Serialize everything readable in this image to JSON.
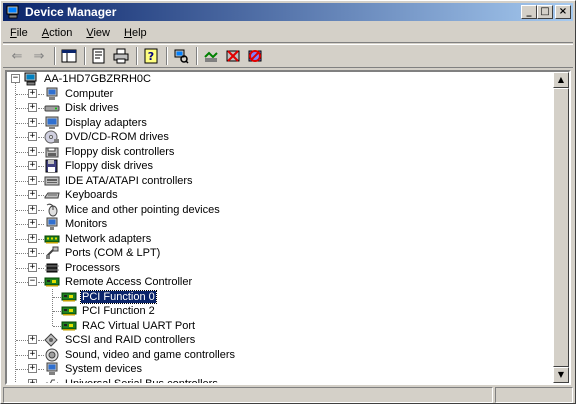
{
  "window": {
    "title": "Device Manager"
  },
  "menu": [
    {
      "label": "File",
      "key": "F"
    },
    {
      "label": "Action",
      "key": "A"
    },
    {
      "label": "View",
      "key": "V"
    },
    {
      "label": "Help",
      "key": "H"
    }
  ],
  "tree": {
    "root": "AA-1HD7GBZRRH0C",
    "items": [
      {
        "label": "Computer",
        "icon": "computer-icon",
        "expander": "+"
      },
      {
        "label": "Disk drives",
        "icon": "disk-drive-icon",
        "expander": "+"
      },
      {
        "label": "Display adapters",
        "icon": "display-adapter-icon",
        "expander": "+"
      },
      {
        "label": "DVD/CD-ROM drives",
        "icon": "cdrom-icon",
        "expander": "+"
      },
      {
        "label": "Floppy disk controllers",
        "icon": "floppy-controller-icon",
        "expander": "+"
      },
      {
        "label": "Floppy disk drives",
        "icon": "floppy-drive-icon",
        "expander": "+"
      },
      {
        "label": "IDE ATA/ATAPI controllers",
        "icon": "ide-controller-icon",
        "expander": "+"
      },
      {
        "label": "Keyboards",
        "icon": "keyboard-icon",
        "expander": "+"
      },
      {
        "label": "Mice and other pointing devices",
        "icon": "mouse-icon",
        "expander": "+"
      },
      {
        "label": "Monitors",
        "icon": "monitor-icon",
        "expander": "+"
      },
      {
        "label": "Network adapters",
        "icon": "network-adapter-icon",
        "expander": "+"
      },
      {
        "label": "Ports (COM & LPT)",
        "icon": "port-icon",
        "expander": "+"
      },
      {
        "label": "Processors",
        "icon": "processor-icon",
        "expander": "+"
      },
      {
        "label": "Remote Access Controller",
        "icon": "board-icon",
        "expander": "-",
        "children": [
          {
            "label": "PCI Function 0",
            "icon": "board-icon",
            "selected": true
          },
          {
            "label": "PCI Function 2",
            "icon": "board-icon"
          },
          {
            "label": "RAC Virtual UART Port",
            "icon": "board-icon"
          }
        ]
      },
      {
        "label": "SCSI and RAID controllers",
        "icon": "scsi-icon",
        "expander": "+"
      },
      {
        "label": "Sound, video and game controllers",
        "icon": "sound-icon",
        "expander": "+"
      },
      {
        "label": "System devices",
        "icon": "system-device-icon",
        "expander": "+"
      },
      {
        "label": "Universal Serial Bus controllers",
        "icon": "usb-icon",
        "expander": "+"
      }
    ]
  },
  "colors": {
    "titlebar": "#0a246a",
    "selection": "#0a246a",
    "face": "#d4d0c8"
  }
}
